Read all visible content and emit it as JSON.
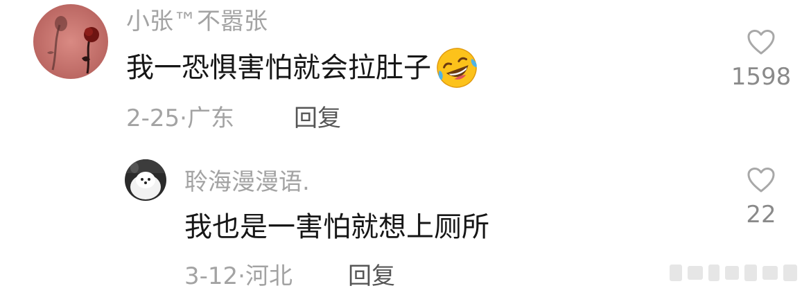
{
  "comments": [
    {
      "username": "小张™不嚣张",
      "text": "我一恐惧害怕就会拉肚子",
      "date": "2-25",
      "location": "广东",
      "reply_label": "回复",
      "like_count": "1598",
      "emoji": "rolling-on-floor-laughing"
    },
    {
      "username": "聆海漫漫语.",
      "text": "我也是一害怕就想上厕所",
      "date": "3-12",
      "location": "河北",
      "reply_label": "回复",
      "like_count": "22"
    }
  ],
  "separator": "·"
}
